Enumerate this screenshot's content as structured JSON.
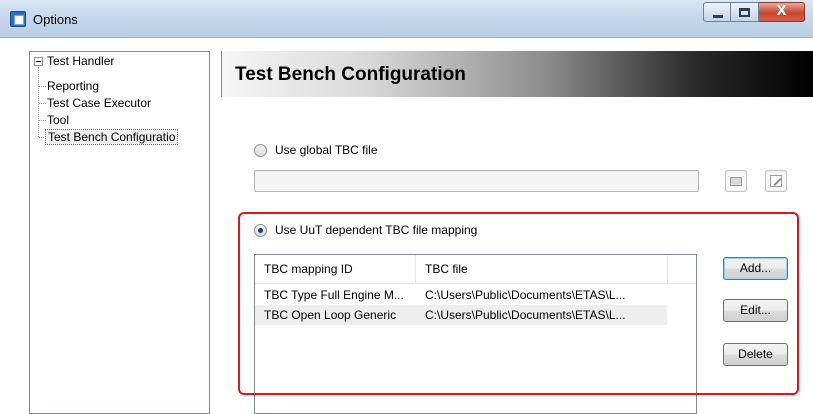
{
  "window": {
    "title": "Options",
    "buttons": {
      "minimize": "minimize",
      "maximize": "maximize",
      "close": "X"
    }
  },
  "tree": {
    "root": "Test Handler",
    "items": [
      {
        "label": "Reporting"
      },
      {
        "label": "Test Case Executor"
      },
      {
        "label": "Tool"
      },
      {
        "label": "Test Bench Configuratio"
      }
    ]
  },
  "page": {
    "title": "Test Bench Configuration",
    "global_option_label": "Use global TBC file",
    "global_path_value": "",
    "uut_option_label": "Use UuT dependent TBC file mapping",
    "table": {
      "columns": [
        "TBC mapping ID",
        "TBC file"
      ],
      "rows": [
        {
          "id": "TBC Type Full Engine M...",
          "file": "C:\\Users\\Public\\Documents\\ETAS\\L..."
        },
        {
          "id": "TBC Open Loop Generic",
          "file": "C:\\Users\\Public\\Documents\\ETAS\\L..."
        }
      ]
    },
    "buttons": {
      "add": "Add...",
      "edit": "Edit...",
      "delete": "Delete"
    }
  },
  "colors": {
    "highlight_border": "#e5141b",
    "title_gradient_end": "#000000"
  },
  "icons": {
    "browse": "folder-icon",
    "edit_file": "edit-file-icon"
  }
}
